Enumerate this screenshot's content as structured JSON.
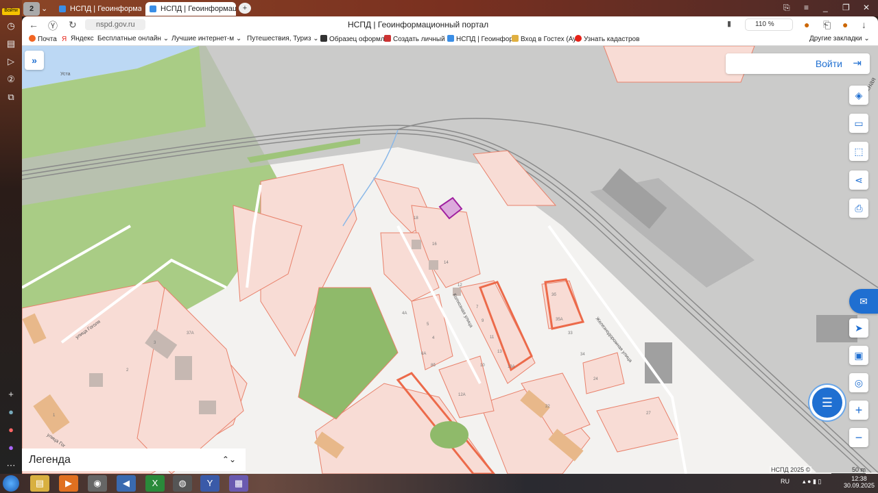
{
  "browser": {
    "profile_login": "Войти",
    "tab_count": "2",
    "tabs": [
      {
        "label": "НСПД | Геоинформационн",
        "active": false
      },
      {
        "label": "НСПД | Геоинформаци",
        "active": true
      }
    ],
    "url": "nspd.gov.ru",
    "page_title": "НСПД | Геоинформационный портал",
    "zoom": "110 %",
    "bookmarks": [
      {
        "label": "Почта",
        "color": "#f26522"
      },
      {
        "label": "Яндекс",
        "color": "#e62117"
      },
      {
        "label": "Бесплатные онлайн ⌄",
        "color": ""
      },
      {
        "label": "Лучшие интернет-м ⌄",
        "color": ""
      },
      {
        "label": "Путешествия, Туриз ⌄",
        "color": ""
      },
      {
        "label": "Образец оформл",
        "color": "#333"
      },
      {
        "label": "Создать личный",
        "color": "#c33"
      },
      {
        "label": "НСПД | Геоинфор",
        "color": "#3a8ee6"
      },
      {
        "label": "Вход в Гостех (Ау",
        "color": "#e0b040"
      },
      {
        "label": "Узнать кадастров",
        "color": "#e62117"
      }
    ],
    "other_bookmarks": "Другие закладки ⌄"
  },
  "map": {
    "login_label": "Войти",
    "legend_label": "Легенда",
    "attribution": "НСПД 2025 ©",
    "scale_label": "50 m",
    "labels": {
      "river": "Уста",
      "street_kolkhoznaya": "Колхозная улица",
      "street_railway": "Железнодорожная улица",
      "street_partial_top": "режная",
      "street_g1": "улица Гоголя",
      "street_g2": "улица Гог"
    },
    "house_numbers": [
      "18",
      "16",
      "14",
      "12",
      "7",
      "9",
      "11",
      "13",
      "13А",
      "3б",
      "35А",
      "33",
      "34",
      "4А",
      "6А",
      "8б",
      "10",
      "12А",
      "22",
      "27",
      "24",
      "5",
      "4",
      "2",
      "3",
      "1",
      "37А"
    ],
    "accent_color": "#1f6fd1",
    "highlight_color": "#a020a0"
  },
  "taskbar": {
    "lang": "RU",
    "time": "12:38",
    "date": "30.09.2025"
  }
}
